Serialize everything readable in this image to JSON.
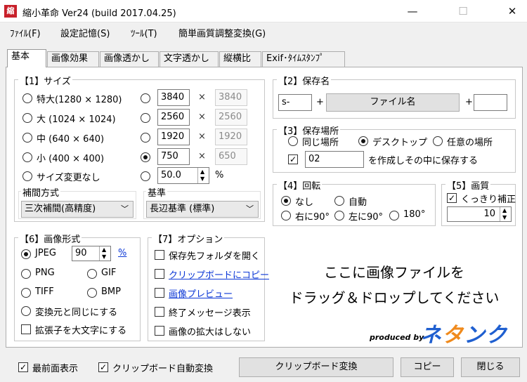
{
  "window": {
    "title": "縮小革命 Ver24 (build 2017.04.25)",
    "icon_text": "縮",
    "minimize": "—",
    "maximize": "☐",
    "close": "✕"
  },
  "menu": [
    "ﾌｧｲﾙ(F)",
    "設定記憶(S)",
    "ﾂｰﾙ(T)",
    "簡単画質調整変換(G)"
  ],
  "tabs": [
    "基本",
    "画像効果",
    "画像透かし",
    "文字透かし",
    "縦横比",
    "Exif･ﾀｲﾑｽﾀﾝﾌﾟ"
  ],
  "size_group": {
    "title": "【1】サイズ",
    "presets": [
      {
        "label": "特大(1280 × 1280)",
        "selected": false
      },
      {
        "label": "大 (1024 × 1024)",
        "selected": false
      },
      {
        "label": "中 (640 × 640)",
        "selected": false
      },
      {
        "label": "小 (400 × 400)",
        "selected": false
      },
      {
        "label": "サイズ変更なし",
        "selected": false
      }
    ],
    "custom": [
      {
        "width": "3840",
        "height": "3840",
        "selected": false
      },
      {
        "width": "2560",
        "height": "2560",
        "selected": false
      },
      {
        "width": "1920",
        "height": "1920",
        "selected": false
      },
      {
        "width": "750",
        "height": "650",
        "selected": true
      }
    ],
    "times": "×",
    "percent_value": "50.0",
    "percent_unit": "%",
    "interp_label": "補間方式",
    "interp_value": "三次補間(高精度)",
    "basis_label": "基準",
    "basis_value": "長辺基準 (標準)"
  },
  "save_name": {
    "title": "【2】保存名",
    "prefix": "s-",
    "plus": "+",
    "name_button": "ファイル名",
    "suffix": ""
  },
  "save_location": {
    "title": "【3】保存場所",
    "options": [
      {
        "label": "同じ場所",
        "selected": false
      },
      {
        "label": "デスクトップ",
        "selected": true
      },
      {
        "label": "任意の場所",
        "selected": false
      }
    ],
    "subfolder_checked": true,
    "subfolder_name": "02",
    "subfolder_label": "を作成しその中に保存する"
  },
  "rotation": {
    "title": "【4】回転",
    "options": [
      {
        "label": "なし",
        "selected": true
      },
      {
        "label": "自動",
        "selected": false
      },
      {
        "label": "右に90°",
        "selected": false
      },
      {
        "label": "左に90°",
        "selected": false
      },
      {
        "label": "180°",
        "selected": false
      }
    ]
  },
  "quality": {
    "title": "【5】画質",
    "sharpen_label": "くっきり補正",
    "sharpen_checked": true,
    "value": "10"
  },
  "format": {
    "title": "【6】画像形式",
    "jpeg_label": "JPEG",
    "jpeg_quality": "90",
    "percent_link": "%",
    "options": [
      {
        "label": "JPEG",
        "selected": true
      },
      {
        "label": "PNG",
        "selected": false
      },
      {
        "label": "GIF",
        "selected": false
      },
      {
        "label": "TIFF",
        "selected": false
      },
      {
        "label": "BMP",
        "selected": false
      },
      {
        "label": "変換元と同じにする",
        "selected": false
      }
    ],
    "uppercase_ext_label": "拡張子を大文字にする",
    "uppercase_ext_checked": false
  },
  "options": {
    "title": "【7】オプション",
    "items": [
      {
        "label": "保存先フォルダを開く",
        "checked": false,
        "link": false
      },
      {
        "label": "クリップボードにコピー",
        "checked": false,
        "link": true
      },
      {
        "label": "画像プレビュー",
        "checked": false,
        "link": true
      },
      {
        "label": "終了メッセージ表示",
        "checked": false,
        "link": false
      },
      {
        "label": "画像の拡大はしない",
        "checked": false,
        "link": false
      }
    ]
  },
  "drop_area": {
    "line1": "ここに画像ファイルを",
    "line2": "ドラッグ＆ドロップしてください",
    "produced_by": "produced by",
    "brand": "ネタンク"
  },
  "footer": {
    "always_on_top_label": "最前面表示",
    "always_on_top_checked": true,
    "clipboard_auto_label": "クリップボード自動変換",
    "clipboard_auto_checked": true,
    "clipboard_convert_button": "クリップボード変換",
    "copy_button": "コピー",
    "close_button": "閉じる"
  },
  "colors": {
    "brand_blue": "#1f5fd0",
    "brand_orange": "#f08a1c",
    "link": "#0b37d6"
  }
}
